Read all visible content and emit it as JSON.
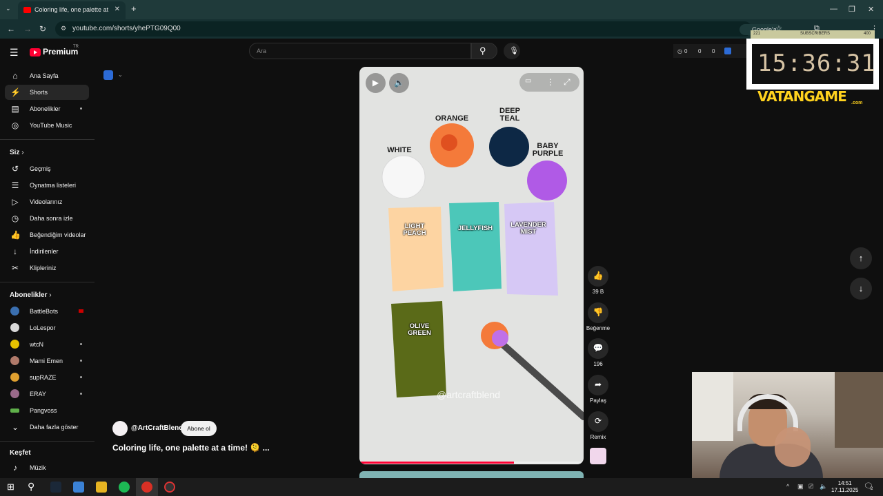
{
  "browser": {
    "tab_title": "Coloring life, one palette at a time!",
    "tab_close": "✕",
    "new_tab": "+",
    "url": "youtube.com/shorts/yhePTG09Q00",
    "google_sor": "Google'a Sor"
  },
  "header": {
    "logo": "Premium",
    "region": "TR",
    "search_placeholder": "Ara",
    "stats": [
      "0",
      "0",
      "0"
    ]
  },
  "sidebar": {
    "main": [
      {
        "label": "Ana Sayfa",
        "icon": "⌂"
      },
      {
        "label": "Shorts",
        "icon": "⚡"
      },
      {
        "label": "Abonelikler",
        "icon": "▤"
      },
      {
        "label": "YouTube Music",
        "icon": "◎"
      }
    ],
    "you_heading": "Siz",
    "you": [
      {
        "label": "Geçmiş",
        "icon": "↺"
      },
      {
        "label": "Oynatma listeleri",
        "icon": "☰"
      },
      {
        "label": "Videolarınız",
        "icon": "▷"
      },
      {
        "label": "Daha sonra izle",
        "icon": "◷"
      },
      {
        "label": "Beğendiğim videolar",
        "icon": "👍"
      },
      {
        "label": "İndirilenler",
        "icon": "↓"
      },
      {
        "label": "Klipleriniz",
        "icon": "✂"
      }
    ],
    "subs_heading": "Abonelikler",
    "subs": [
      {
        "label": "BattleBots",
        "color": "#3a6fb0"
      },
      {
        "label": "LoLespor",
        "color": "#d8d8d8"
      },
      {
        "label": "wtcN",
        "color": "#e6c200"
      },
      {
        "label": "Mami Emen",
        "color": "#b07a6a"
      },
      {
        "label": "supRAZE",
        "color": "#e0a030"
      },
      {
        "label": "ERAY",
        "color": "#9a6a8a"
      },
      {
        "label": "Pangvoss",
        "color": "#5fb04a"
      }
    ],
    "show_more": "Daha fazla göster",
    "explore_heading": "Keşfet",
    "explore": [
      {
        "label": "Müzik",
        "icon": "♪"
      }
    ]
  },
  "short": {
    "colors": {
      "white": "WHITE",
      "orange": "ORANGE",
      "deep_teal": "DEEP TEAL",
      "baby_purple": "BABY PURPLE"
    },
    "swatches": {
      "light_peach": "LIGHT PEACH",
      "jellyfish": "JELLYFISH",
      "lavender_mist": "LAVENDER MIST",
      "olive_green": "OLIVE GREEN"
    },
    "watermark": "@artcraftblend",
    "progress": 0.69,
    "channel": "@ArtCraftBlend",
    "subscribe": "Abone ol",
    "title": "Coloring life, one palette at a time! 🫠 ..."
  },
  "actions": {
    "likes": "39 B",
    "dislike": "Beğenme",
    "comments": "196",
    "share": "Paylaş",
    "remix": "Remix"
  },
  "overlay": {
    "count_left": "221",
    "subscribers": "SUBSCRIBERS",
    "count_right": "400",
    "clock": "15:36:31",
    "brand": "VATANGAME",
    "brand_suffix": ".com"
  },
  "taskbar": {
    "time": "14:51",
    "date": "17.11.2025",
    "notif": "2"
  }
}
